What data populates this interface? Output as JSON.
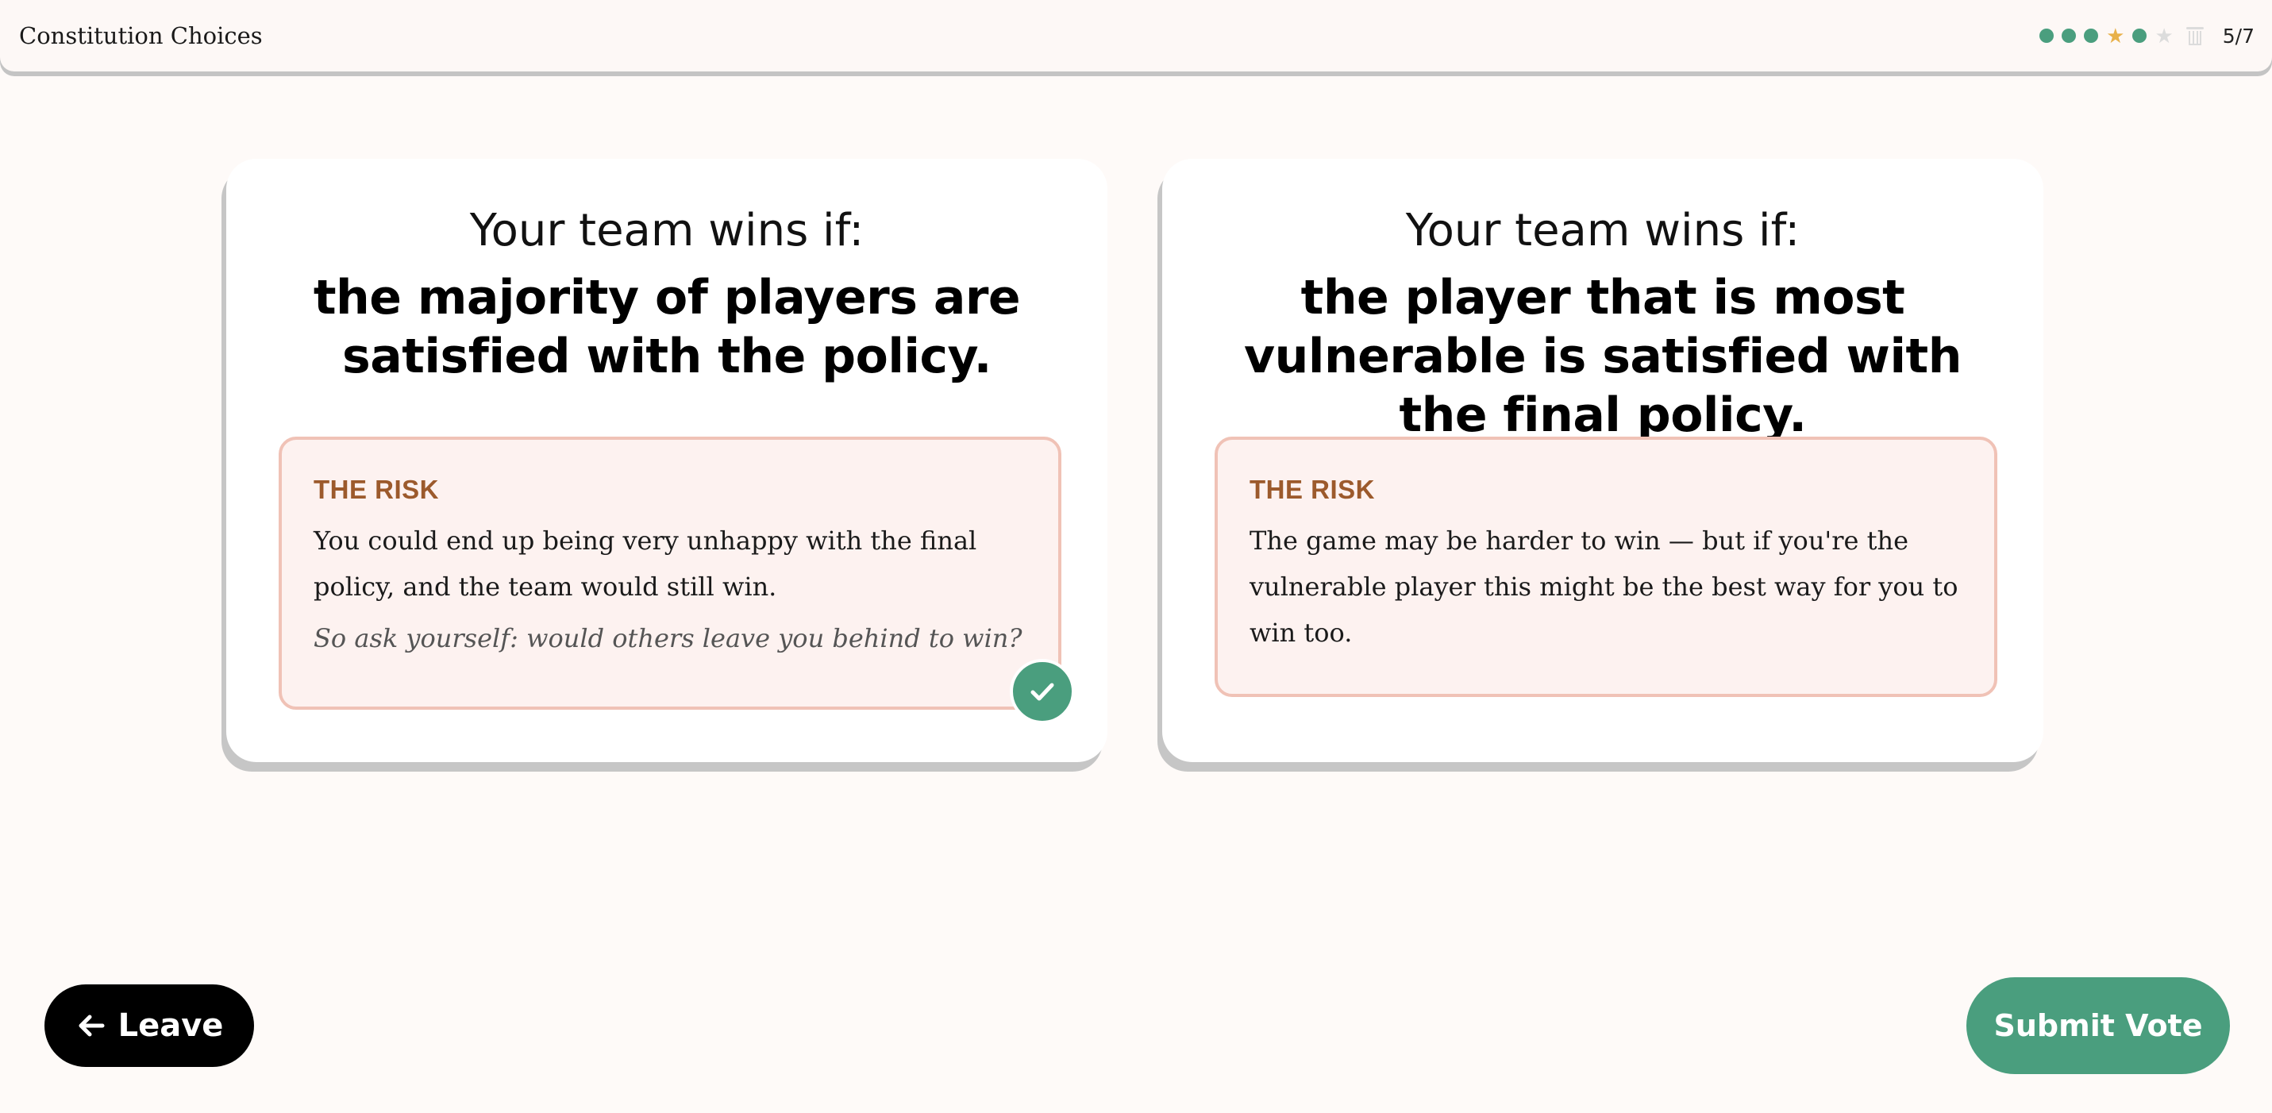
{
  "header": {
    "title": "Constitution Choices",
    "progress": {
      "steps": [
        {
          "type": "dot",
          "state": "complete",
          "color": "#4a9e7e"
        },
        {
          "type": "dot",
          "state": "complete",
          "color": "#4a9e7e"
        },
        {
          "type": "dot",
          "state": "complete",
          "color": "#4a9e7e"
        },
        {
          "type": "star",
          "state": "complete",
          "color": "#e8b14a"
        },
        {
          "type": "dot",
          "state": "complete",
          "color": "#4a9e7e"
        },
        {
          "type": "star",
          "state": "pending",
          "color": "#dcdcdc"
        },
        {
          "type": "trash",
          "state": "pending",
          "color": "#dcdcdc"
        }
      ],
      "count": "5/7"
    }
  },
  "options": [
    {
      "lead": "Your team wins if:",
      "headline": "the majority of players are satisfied with the policy.",
      "risk_label": "THE RISK",
      "risk_body": "You could end up being very unhappy with the final policy, and the team would still win.",
      "risk_question": "So ask yourself: would others leave you behind to win?",
      "selected": true
    },
    {
      "lead": "Your team wins if:",
      "headline": "the player that is most vulnerable is satisfied with the final policy.",
      "risk_label": "THE RISK",
      "risk_body": "The game may be harder to win — but if you're the vulnerable player this might be the best way for you to win too.",
      "selected": false
    }
  ],
  "footer": {
    "leave_label": "Leave",
    "submit_label": "Submit Vote"
  },
  "colors": {
    "accent": "#4a9e7e",
    "risk_label": "#9c5a2c",
    "risk_bg": "#fdf2f0",
    "risk_border": "#f0c2b6",
    "page_bg": "#fefaf8"
  }
}
